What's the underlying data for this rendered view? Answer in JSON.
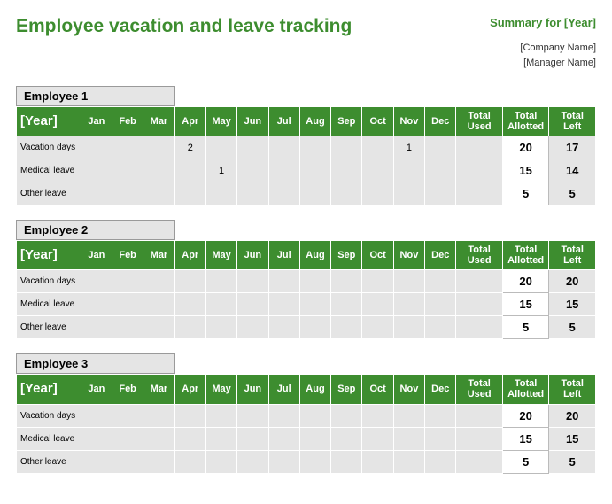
{
  "title": "Employee vacation and leave tracking",
  "summary_label": "Summary for [Year]",
  "company_name": "[Company Name]",
  "manager_name": "[Manager Name]",
  "year_header": "[Year]",
  "month_headers": [
    "Jan",
    "Feb",
    "Mar",
    "Apr",
    "May",
    "Jun",
    "Jul",
    "Aug",
    "Sep",
    "Oct",
    "Nov",
    "Dec"
  ],
  "total_headers": {
    "used": "Total Used",
    "allotted": "Total Allotted",
    "left": "Total Left"
  },
  "row_labels": {
    "vacation": "Vacation days",
    "medical": "Medical leave",
    "other": "Other leave"
  },
  "employees": [
    {
      "name": "Employee 1",
      "rows": [
        {
          "label_key": "vacation",
          "months": [
            "",
            "",
            "",
            "2",
            "",
            "",
            "",
            "",
            "",
            "",
            "1",
            ""
          ],
          "used": "",
          "allotted": "20",
          "left": "17"
        },
        {
          "label_key": "medical",
          "months": [
            "",
            "",
            "",
            "",
            "1",
            "",
            "",
            "",
            "",
            "",
            "",
            ""
          ],
          "used": "",
          "allotted": "15",
          "left": "14"
        },
        {
          "label_key": "other",
          "months": [
            "",
            "",
            "",
            "",
            "",
            "",
            "",
            "",
            "",
            "",
            "",
            ""
          ],
          "used": "",
          "allotted": "5",
          "left": "5"
        }
      ]
    },
    {
      "name": "Employee 2",
      "rows": [
        {
          "label_key": "vacation",
          "months": [
            "",
            "",
            "",
            "",
            "",
            "",
            "",
            "",
            "",
            "",
            "",
            ""
          ],
          "used": "",
          "allotted": "20",
          "left": "20"
        },
        {
          "label_key": "medical",
          "months": [
            "",
            "",
            "",
            "",
            "",
            "",
            "",
            "",
            "",
            "",
            "",
            ""
          ],
          "used": "",
          "allotted": "15",
          "left": "15"
        },
        {
          "label_key": "other",
          "months": [
            "",
            "",
            "",
            "",
            "",
            "",
            "",
            "",
            "",
            "",
            "",
            ""
          ],
          "used": "",
          "allotted": "5",
          "left": "5"
        }
      ]
    },
    {
      "name": "Employee 3",
      "rows": [
        {
          "label_key": "vacation",
          "months": [
            "",
            "",
            "",
            "",
            "",
            "",
            "",
            "",
            "",
            "",
            "",
            ""
          ],
          "used": "",
          "allotted": "20",
          "left": "20"
        },
        {
          "label_key": "medical",
          "months": [
            "",
            "",
            "",
            "",
            "",
            "",
            "",
            "",
            "",
            "",
            "",
            ""
          ],
          "used": "",
          "allotted": "15",
          "left": "15"
        },
        {
          "label_key": "other",
          "months": [
            "",
            "",
            "",
            "",
            "",
            "",
            "",
            "",
            "",
            "",
            "",
            ""
          ],
          "used": "",
          "allotted": "5",
          "left": "5"
        }
      ]
    }
  ]
}
